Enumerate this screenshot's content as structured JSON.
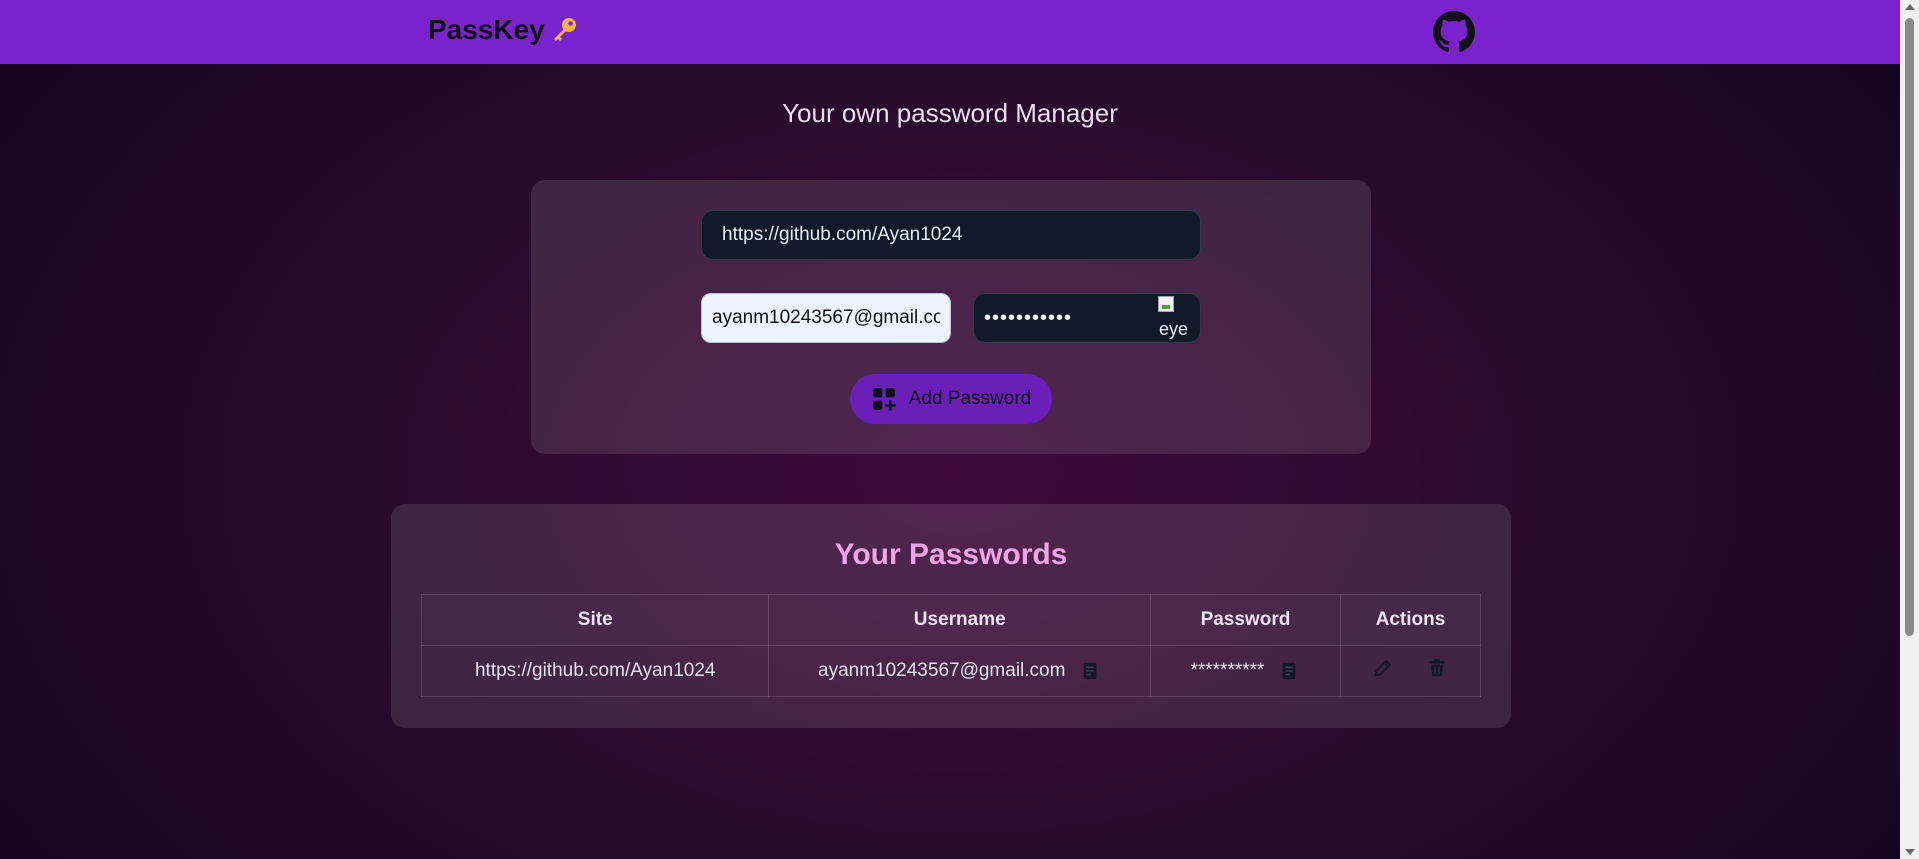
{
  "navbar": {
    "brand": "PassKey",
    "logo_icon": "key-icon",
    "github_icon": "github-icon"
  },
  "tagline": "Your own password Manager",
  "form": {
    "site_value": "https://github.com/Ayan1024",
    "username_value": "ayanm10243567@gmail.com",
    "password_value": "***********",
    "eye_alt": "eye",
    "add_button_label": "Add Password",
    "add_button_icon": "add-grid-icon"
  },
  "passwords": {
    "title": "Your Passwords",
    "columns": [
      "Site",
      "Username",
      "Password",
      "Actions"
    ],
    "rows": [
      {
        "site": "https://github.com/Ayan1024",
        "username": "ayanm10243567@gmail.com",
        "password": "**********"
      }
    ]
  },
  "colors": {
    "navbar": "#7b22cf",
    "accent_title": "#f3a3e6",
    "button": "#6a1fb8"
  }
}
